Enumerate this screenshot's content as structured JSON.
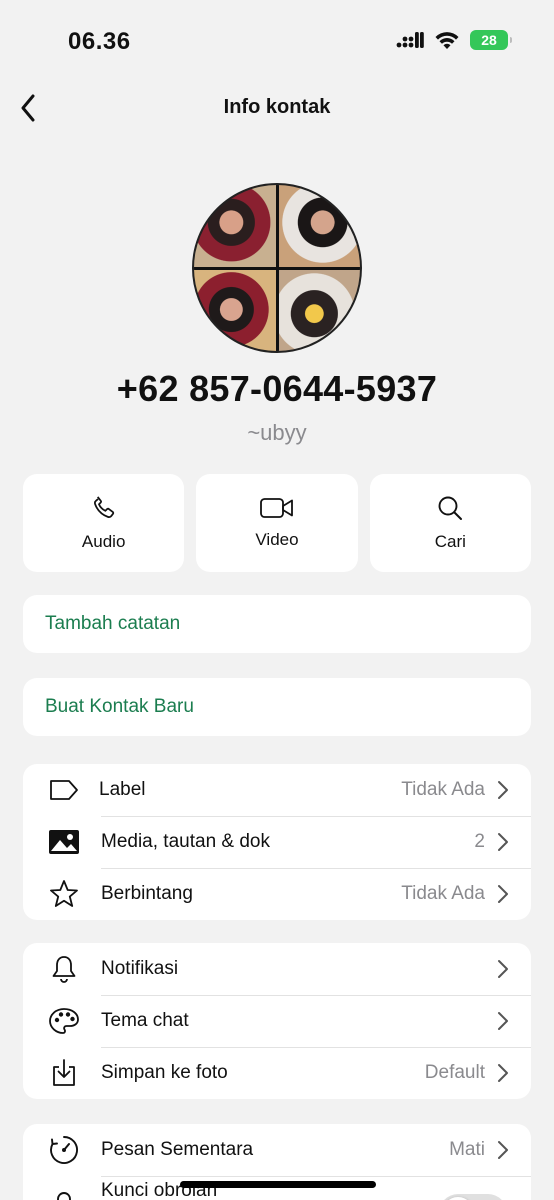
{
  "status_bar": {
    "time": "06.36",
    "battery": "28",
    "icons": [
      "cellular-signal-icon",
      "wifi-icon",
      "battery-icon"
    ]
  },
  "header": {
    "title": "Info kontak",
    "back_icon": "chevron-left-icon"
  },
  "profile": {
    "avatar": "profile-photo-collage",
    "phone": "+62 857-0644-5937",
    "username": "~ubyy"
  },
  "actions": [
    {
      "label": "Audio",
      "icon": "phone-icon"
    },
    {
      "label": "Video",
      "icon": "video-camera-icon"
    },
    {
      "label": "Cari",
      "icon": "search-icon"
    }
  ],
  "links": {
    "add_note": "Tambah catatan",
    "new_contact": "Buat Kontak Baru"
  },
  "group1": [
    {
      "label": "Label",
      "value": "Tidak Ada",
      "icon": "tag-icon"
    },
    {
      "label": "Media, tautan & dok",
      "value": "2",
      "icon": "photo-icon"
    },
    {
      "label": "Berbintang",
      "value": "Tidak Ada",
      "icon": "star-icon"
    }
  ],
  "group2": [
    {
      "label": "Notifikasi",
      "value": "",
      "icon": "bell-icon"
    },
    {
      "label": "Tema chat",
      "value": "",
      "icon": "palette-icon"
    },
    {
      "label": "Simpan ke foto",
      "value": "Default",
      "icon": "save-download-icon"
    }
  ],
  "group3": [
    {
      "label": "Pesan Sementara",
      "value": "Mati",
      "icon": "timer-icon"
    },
    {
      "label": "Kunci obrolan",
      "value": "",
      "icon": "lock-icon",
      "toggle": false
    }
  ],
  "colors": {
    "accent_green": "#1b7d4f",
    "background": "#f2f2f2",
    "secondary_text": "#8a8a8e",
    "battery_green": "#34c759"
  }
}
